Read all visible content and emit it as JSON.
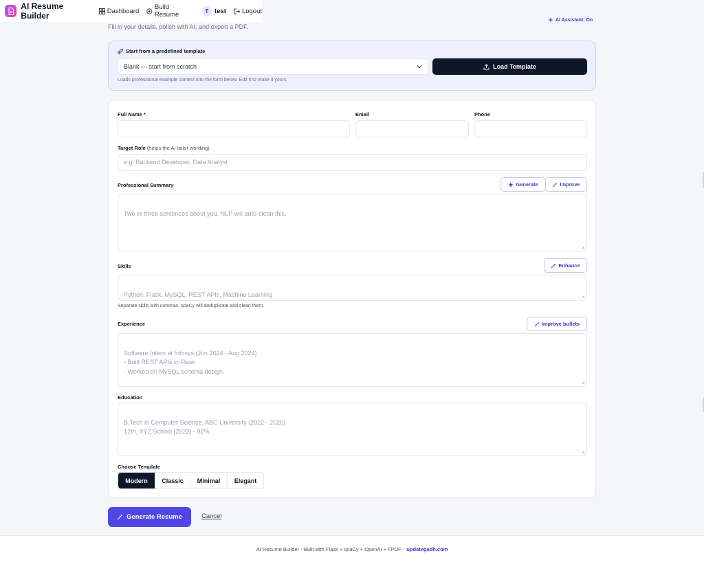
{
  "nav": {
    "brand": "AI Resume Builder",
    "dashboard": "Dashboard",
    "build_resume": "Build Resume",
    "avatar_initial": "T",
    "username": "test",
    "logout": "Logout"
  },
  "page": {
    "subtitle": "Fill in your details, polish with AI, and export a PDF.",
    "ai_status": "AI Assistant: On"
  },
  "template_banner": {
    "heading": "Start from a predefined template",
    "selected_option": "Blank — start from scratch",
    "load_button": "Load Template",
    "help": "Loads professional example content into the form below. Edit it to make it yours."
  },
  "form": {
    "full_name": {
      "label": "Full Name *",
      "value": ""
    },
    "email": {
      "label": "Email",
      "value": ""
    },
    "phone": {
      "label": "Phone",
      "value": ""
    },
    "target_role": {
      "label": "Target Role",
      "hint": "(helps the AI tailor wording)",
      "placeholder": "e.g. Backend Developer, Data Analyst"
    },
    "summary": {
      "label": "Professional Summary",
      "placeholder": "Two or three sentences about you. NLP will auto-clean this.",
      "generate_button": "Generate",
      "improve_button": "Improve"
    },
    "skills": {
      "label": "Skills",
      "placeholder": "Python, Flask, MySQL, REST APIs, Machine Learning",
      "enhance_button": "Enhance",
      "help": "Separate skills with commas. spaCy will deduplicate and clean them."
    },
    "experience": {
      "label": "Experience",
      "placeholder": "Software Intern at Infosys (Jun 2024 - Aug 2024)\n- Built REST APIs in Flask\n- Worked on MySQL schema design",
      "improve_button": "Improve bullets"
    },
    "education": {
      "label": "Education",
      "placeholder": "B.Tech in Computer Science, ABC University (2022 - 2026)\n12th, XYZ School (2022) - 92%"
    },
    "choose_template": {
      "label": "Choose Template",
      "options": [
        "Modern",
        "Classic",
        "Minimal",
        "Elegant"
      ],
      "selected": "Modern"
    }
  },
  "actions": {
    "generate": "Generate Resume",
    "cancel": "Cancel"
  },
  "footer": {
    "text": "AI Resume Builder · Built with Flask + spaCy + OpenAI + FPDF ·",
    "link": "updategadh.com"
  },
  "colors": {
    "primary": "#4f46e5",
    "dark": "#0f172a",
    "banner_bg": "#eef1fd",
    "accent_text": "#4338ca"
  }
}
